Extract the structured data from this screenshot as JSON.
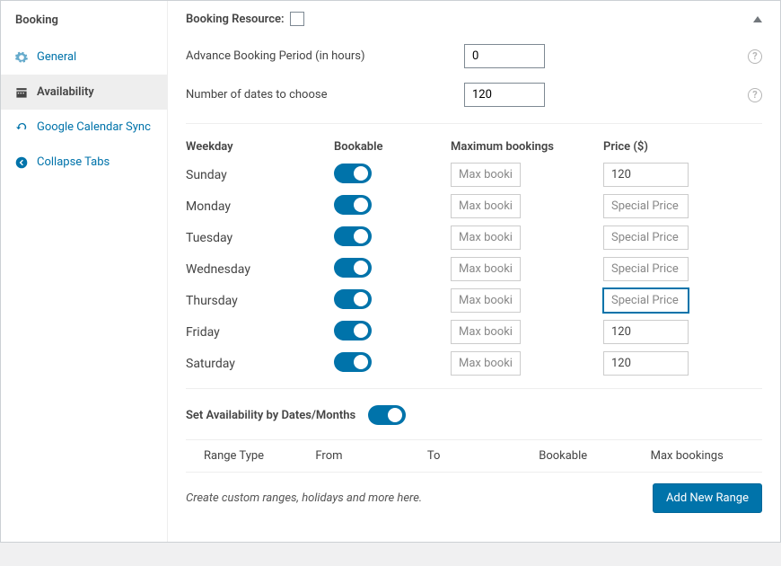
{
  "sidebar": {
    "title": "Booking",
    "items": [
      {
        "label": "General"
      },
      {
        "label": "Availability"
      },
      {
        "label": "Google Calendar Sync"
      },
      {
        "label": "Collapse Tabs"
      }
    ]
  },
  "header": {
    "label": "Booking Resource:"
  },
  "form": {
    "advance_label": "Advance Booking Period (in hours)",
    "advance_value": "0",
    "dates_label": "Number of dates to choose",
    "dates_value": "120"
  },
  "week": {
    "headers": {
      "day": "Weekday",
      "bookable": "Bookable",
      "max": "Maximum bookings",
      "price": "Price ($)"
    },
    "max_placeholder": "Max bookings",
    "price_placeholder": "Special Price",
    "days": [
      {
        "name": "Sunday",
        "bookable": true,
        "max": "",
        "price": "120"
      },
      {
        "name": "Monday",
        "bookable": true,
        "max": "",
        "price": ""
      },
      {
        "name": "Tuesday",
        "bookable": true,
        "max": "",
        "price": ""
      },
      {
        "name": "Wednesday",
        "bookable": true,
        "max": "",
        "price": ""
      },
      {
        "name": "Thursday",
        "bookable": true,
        "max": "",
        "price": "",
        "focused": true
      },
      {
        "name": "Friday",
        "bookable": true,
        "max": "",
        "price": "120"
      },
      {
        "name": "Saturday",
        "bookable": true,
        "max": "",
        "price": "120"
      }
    ]
  },
  "avail_toggle_label": "Set Availability by Dates/Months",
  "ranges": {
    "headers": {
      "type": "Range Type",
      "from": "From",
      "to": "To",
      "bookable": "Bookable",
      "max": "Max bookings"
    },
    "empty_msg": "Create custom ranges, holidays and more here.",
    "add_button": "Add New Range"
  }
}
